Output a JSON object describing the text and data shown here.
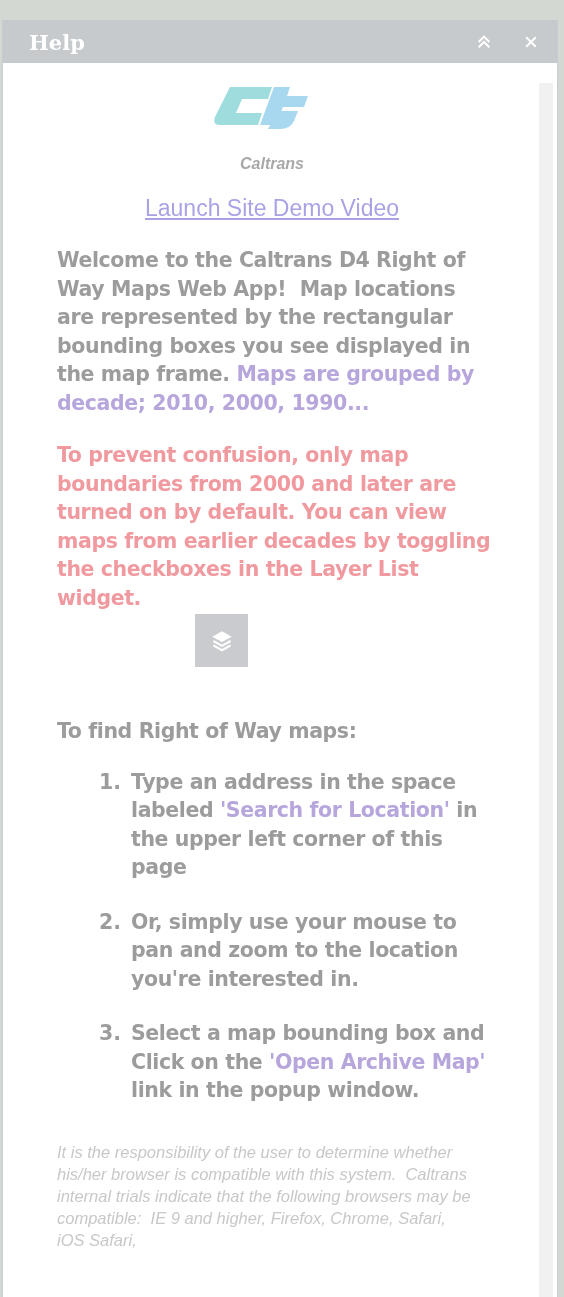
{
  "panel": {
    "title": "Help",
    "buttons": [
      {
        "kind": "collapse"
      },
      {
        "kind": "close"
      }
    ]
  },
  "logo": {
    "wordmark": "Caltrans"
  },
  "demo_link": "Launch Site Demo Video",
  "intro": [
    {
      "kind": "plain",
      "text": "Welcome to the Caltrans D4 Right of Way Maps Web App!  Map locations are represented by the rectangular bounding boxes you see displayed in the map frame. "
    },
    {
      "kind": "highlight",
      "text": "Maps are grouped by decade; 2010, 2000, 1990..."
    }
  ],
  "warning": "To prevent confusion, only map boundaries from 2000 and later are turned on by default. You can view maps from earlier decades by toggling the checkboxes in the Layer List widget.",
  "steps_heading": "To find Right of Way maps:",
  "steps": [
    {
      "number": "1.",
      "parts": [
        {
          "kind": "plain",
          "text": "Type an address in the space labeled "
        },
        {
          "kind": "highlight",
          "text": "'Search for Location'"
        },
        {
          "kind": "plain",
          "text": " in the upper left corner of this page"
        }
      ]
    },
    {
      "number": "2.",
      "parts": [
        {
          "kind": "plain",
          "text": "Or, simply use your mouse to pan and zoom to the location you're interested in."
        }
      ]
    },
    {
      "number": "3.",
      "parts": [
        {
          "kind": "plain",
          "text": "Select a map bounding box and Click on the "
        },
        {
          "kind": "highlight",
          "text": "'Open Archive Map'"
        },
        {
          "kind": "plain",
          "text": " link in the popup window."
        }
      ]
    }
  ],
  "disclaimer": "It is the responsibility of the user to determine whether his/her browser is compatible with this system.  Caltrans internal trials indicate that the following browsers may be compatible:  IE 9 and higher, Firefox, Chrome, Safari, iOS Safari,"
}
